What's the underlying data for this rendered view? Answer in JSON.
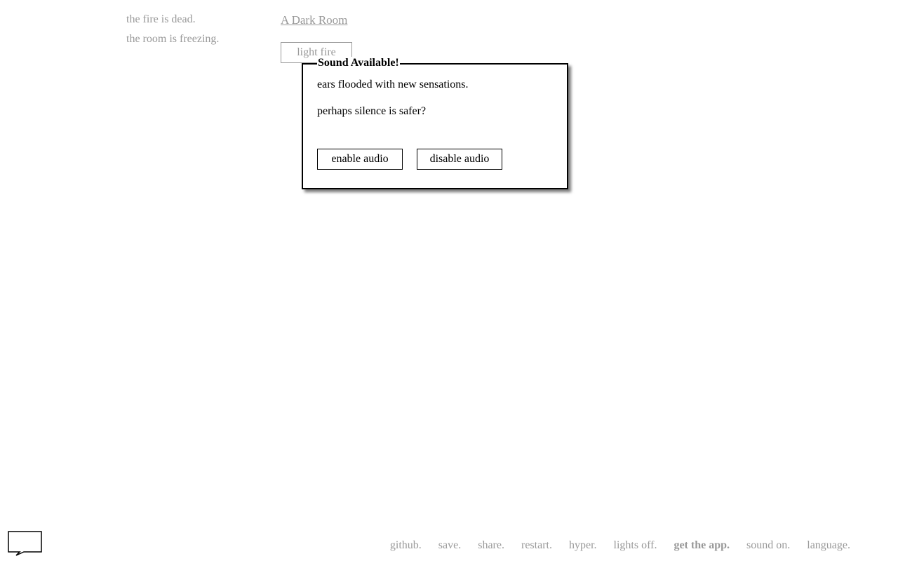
{
  "notifications": [
    "the fire is dead.",
    "the room is freezing."
  ],
  "location": {
    "title": "A Dark Room"
  },
  "actions": {
    "light_fire": "light fire"
  },
  "event": {
    "title": "Sound Available!",
    "text": [
      "ears flooded with new sensations.",
      "perhaps silence is safer?"
    ],
    "buttons": {
      "enable": "enable audio",
      "disable": "disable audio"
    }
  },
  "footer": {
    "links": [
      "github.",
      "save.",
      "share.",
      "restart.",
      "hyper.",
      "lights off.",
      "get the app.",
      "sound on.",
      "language."
    ]
  },
  "icons": {
    "chat": "speech-bubble-icon"
  },
  "colors": {
    "muted_text": "#999999",
    "border": "#000000",
    "background": "#ffffff"
  }
}
